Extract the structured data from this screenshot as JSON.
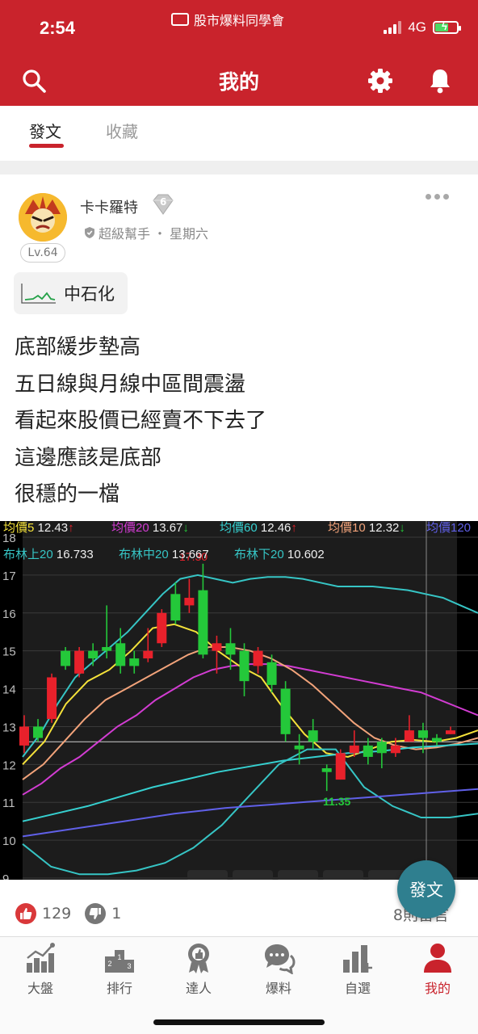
{
  "status_bar": {
    "time": "2:54",
    "carrier_label": "股市爆料同學會",
    "network": "4G"
  },
  "header": {
    "title": "我的",
    "icons": [
      "search-icon",
      "gear-icon",
      "bell-icon"
    ],
    "bar_color": "#c9232c"
  },
  "tabs": [
    {
      "label": "發文",
      "active": true
    },
    {
      "label": "收藏",
      "active": false
    }
  ],
  "post": {
    "author": "卡卡羅特",
    "badge_number": "6",
    "level": "Lv.64",
    "role": "超級幫手",
    "separator": "・",
    "day": "星期六",
    "stock_tag": "中石化",
    "lines": [
      "底部緩步墊高",
      "五日線與月線中區間震盪",
      "看起來股價已經賣不下去了",
      "這邊應該是底部",
      "很穩的一檔"
    ],
    "likes": "129",
    "dislikes": "1",
    "comments": "8則留言"
  },
  "fab_label": "發文",
  "bottom_nav": [
    {
      "label": "大盤",
      "icon": "market-chart-icon",
      "active": false
    },
    {
      "label": "排行",
      "icon": "podium-icon",
      "active": false
    },
    {
      "label": "達人",
      "icon": "expert-medal-icon",
      "active": false
    },
    {
      "label": "爆料",
      "icon": "chat-bubbles-icon",
      "active": false
    },
    {
      "label": "自選",
      "icon": "watchlist-chart-icon",
      "active": false
    },
    {
      "label": "我的",
      "icon": "user-icon",
      "active": true
    }
  ],
  "chart_data": {
    "type": "candlestick",
    "legend_row1": [
      {
        "label": "均價5",
        "value": "12.43",
        "arrow": "↑",
        "color": "#f5e23a"
      },
      {
        "label": "均價20",
        "value": "13.67",
        "arrow": "↓",
        "color": "#d23cd2"
      },
      {
        "label": "均價60",
        "value": "12.46",
        "arrow": "↑",
        "color": "#36d0d0"
      },
      {
        "label": "均價10",
        "value": "12.32",
        "arrow": "↓",
        "color": "#f2a37a"
      },
      {
        "label": "均價120",
        "value": "",
        "arrow": "",
        "color": "#6060e8"
      }
    ],
    "legend_row2": [
      {
        "label": "布林上20",
        "value": "16.733"
      },
      {
        "label": "布林中20",
        "value": "13.667"
      },
      {
        "label": "布林下20",
        "value": "10.602"
      }
    ],
    "yticks": [
      18,
      17,
      16,
      15,
      14,
      13,
      12,
      11,
      10,
      9
    ],
    "ylim": [
      9,
      18
    ],
    "high_label": "17.30",
    "low_label": "11.35",
    "ref_line": 12.6,
    "candles": [
      {
        "o": 12.5,
        "c": 13.0,
        "h": 13.3,
        "l": 12.3,
        "up": true
      },
      {
        "o": 13.0,
        "c": 12.7,
        "h": 13.2,
        "l": 12.6,
        "up": false
      },
      {
        "o": 13.2,
        "c": 14.3,
        "h": 14.4,
        "l": 13.1,
        "up": true
      },
      {
        "o": 14.6,
        "c": 15.0,
        "h": 15.1,
        "l": 14.5,
        "up": false
      },
      {
        "o": 14.4,
        "c": 15.0,
        "h": 15.1,
        "l": 14.3,
        "up": true
      },
      {
        "o": 14.8,
        "c": 15.0,
        "h": 15.2,
        "l": 14.6,
        "up": false
      },
      {
        "o": 15.1,
        "c": 15.0,
        "h": 16.2,
        "l": 14.8,
        "up": false
      },
      {
        "o": 15.2,
        "c": 14.6,
        "h": 15.6,
        "l": 14.4,
        "up": false
      },
      {
        "o": 14.8,
        "c": 14.6,
        "h": 15.0,
        "l": 14.4,
        "up": false
      },
      {
        "o": 14.8,
        "c": 15.0,
        "h": 15.6,
        "l": 14.7,
        "up": true
      },
      {
        "o": 15.2,
        "c": 16.0,
        "h": 16.1,
        "l": 15.1,
        "up": true
      },
      {
        "o": 16.5,
        "c": 15.8,
        "h": 16.8,
        "l": 15.7,
        "up": false
      },
      {
        "o": 16.2,
        "c": 16.4,
        "h": 16.9,
        "l": 16.0,
        "up": true
      },
      {
        "o": 16.6,
        "c": 14.9,
        "h": 17.3,
        "l": 14.8,
        "up": false
      },
      {
        "o": 15.0,
        "c": 15.2,
        "h": 15.4,
        "l": 14.4,
        "up": true
      },
      {
        "o": 15.2,
        "c": 14.9,
        "h": 15.6,
        "l": 14.5,
        "up": false
      },
      {
        "o": 15.0,
        "c": 14.2,
        "h": 15.2,
        "l": 13.8,
        "up": false
      },
      {
        "o": 14.6,
        "c": 15.0,
        "h": 15.1,
        "l": 14.4,
        "up": true
      },
      {
        "o": 14.7,
        "c": 14.1,
        "h": 14.9,
        "l": 13.9,
        "up": false
      },
      {
        "o": 14.0,
        "c": 12.8,
        "h": 14.2,
        "l": 12.6,
        "up": false
      },
      {
        "o": 12.5,
        "c": 12.4,
        "h": 12.8,
        "l": 12.0,
        "up": false
      },
      {
        "o": 12.6,
        "c": 12.9,
        "h": 13.2,
        "l": 12.4,
        "up": false
      },
      {
        "o": 11.8,
        "c": 11.9,
        "h": 12.0,
        "l": 11.3,
        "up": false
      },
      {
        "o": 11.6,
        "c": 12.3,
        "h": 12.4,
        "l": 11.6,
        "up": true
      },
      {
        "o": 12.3,
        "c": 12.5,
        "h": 12.9,
        "l": 12.2,
        "up": true
      },
      {
        "o": 12.2,
        "c": 12.5,
        "h": 12.7,
        "l": 12.0,
        "up": false
      },
      {
        "o": 12.3,
        "c": 12.6,
        "h": 12.7,
        "l": 11.9,
        "up": false
      },
      {
        "o": 12.3,
        "c": 12.5,
        "h": 12.7,
        "l": 12.2,
        "up": true
      },
      {
        "o": 12.6,
        "c": 12.9,
        "h": 13.3,
        "l": 12.6,
        "up": true
      },
      {
        "o": 12.7,
        "c": 12.9,
        "h": 13.1,
        "l": 12.3,
        "up": false
      },
      {
        "o": 12.7,
        "c": 12.6,
        "h": 12.8,
        "l": 12.5,
        "up": false
      },
      {
        "o": 12.8,
        "c": 12.9,
        "h": 13.0,
        "l": 12.8,
        "up": true
      }
    ],
    "lines": [
      {
        "name": "布林上",
        "color": "#36c5c5",
        "values": [
          12.2,
          12.8,
          13.6,
          14.3,
          14.7,
          15.1,
          15.5,
          16.0,
          16.5,
          16.9,
          17.0,
          16.9,
          16.8,
          16.9,
          16.95,
          16.95,
          16.9,
          16.8,
          16.7,
          16.7,
          16.7,
          16.65,
          16.6,
          16.5,
          16.4,
          16.2,
          16.0
        ]
      },
      {
        "name": "均價20",
        "color": "#d23cd2",
        "values": [
          11.2,
          11.5,
          11.9,
          12.2,
          12.6,
          13.0,
          13.3,
          13.7,
          14.0,
          14.3,
          14.5,
          14.6,
          14.65,
          14.65,
          14.6,
          14.5,
          14.4,
          14.3,
          14.2,
          14.1,
          14.0,
          13.9,
          13.7,
          13.5,
          13.3
        ]
      },
      {
        "name": "均價10",
        "color": "#f2a37a",
        "values": [
          11.6,
          12.0,
          12.6,
          13.2,
          13.7,
          14.0,
          14.3,
          14.6,
          14.9,
          15.1,
          15.1,
          15.0,
          14.8,
          14.5,
          14.1,
          13.6,
          13.1,
          12.7,
          12.5,
          12.4,
          12.45,
          12.55,
          12.7
        ]
      },
      {
        "name": "均價5",
        "color": "#f5e23a",
        "values": [
          12.0,
          12.6,
          13.6,
          14.2,
          14.5,
          15.0,
          15.6,
          15.7,
          15.5,
          15.0,
          14.6,
          14.3,
          13.5,
          12.8,
          12.3,
          12.2,
          12.4,
          12.6,
          12.65,
          12.6,
          12.7,
          12.9
        ]
      },
      {
        "name": "均價60",
        "color": "#36d0d0",
        "values": [
          10.5,
          10.7,
          10.9,
          11.15,
          11.4,
          11.6,
          11.8,
          11.95,
          12.1,
          12.2,
          12.3,
          12.35,
          12.45,
          12.5,
          12.55
        ]
      },
      {
        "name": "布林下",
        "color": "#36c5c5",
        "values": [
          9.9,
          9.3,
          9.1,
          9.1,
          9.2,
          9.4,
          9.8,
          10.4,
          11.2,
          12.0,
          12.4,
          12.4,
          11.4,
          10.9,
          10.6,
          10.6,
          10.7
        ]
      },
      {
        "name": "均價120",
        "color": "#6060e8",
        "values": [
          10.1,
          10.3,
          10.5,
          10.7,
          10.85,
          10.95,
          11.05,
          11.15,
          11.25,
          11.35
        ]
      }
    ]
  }
}
